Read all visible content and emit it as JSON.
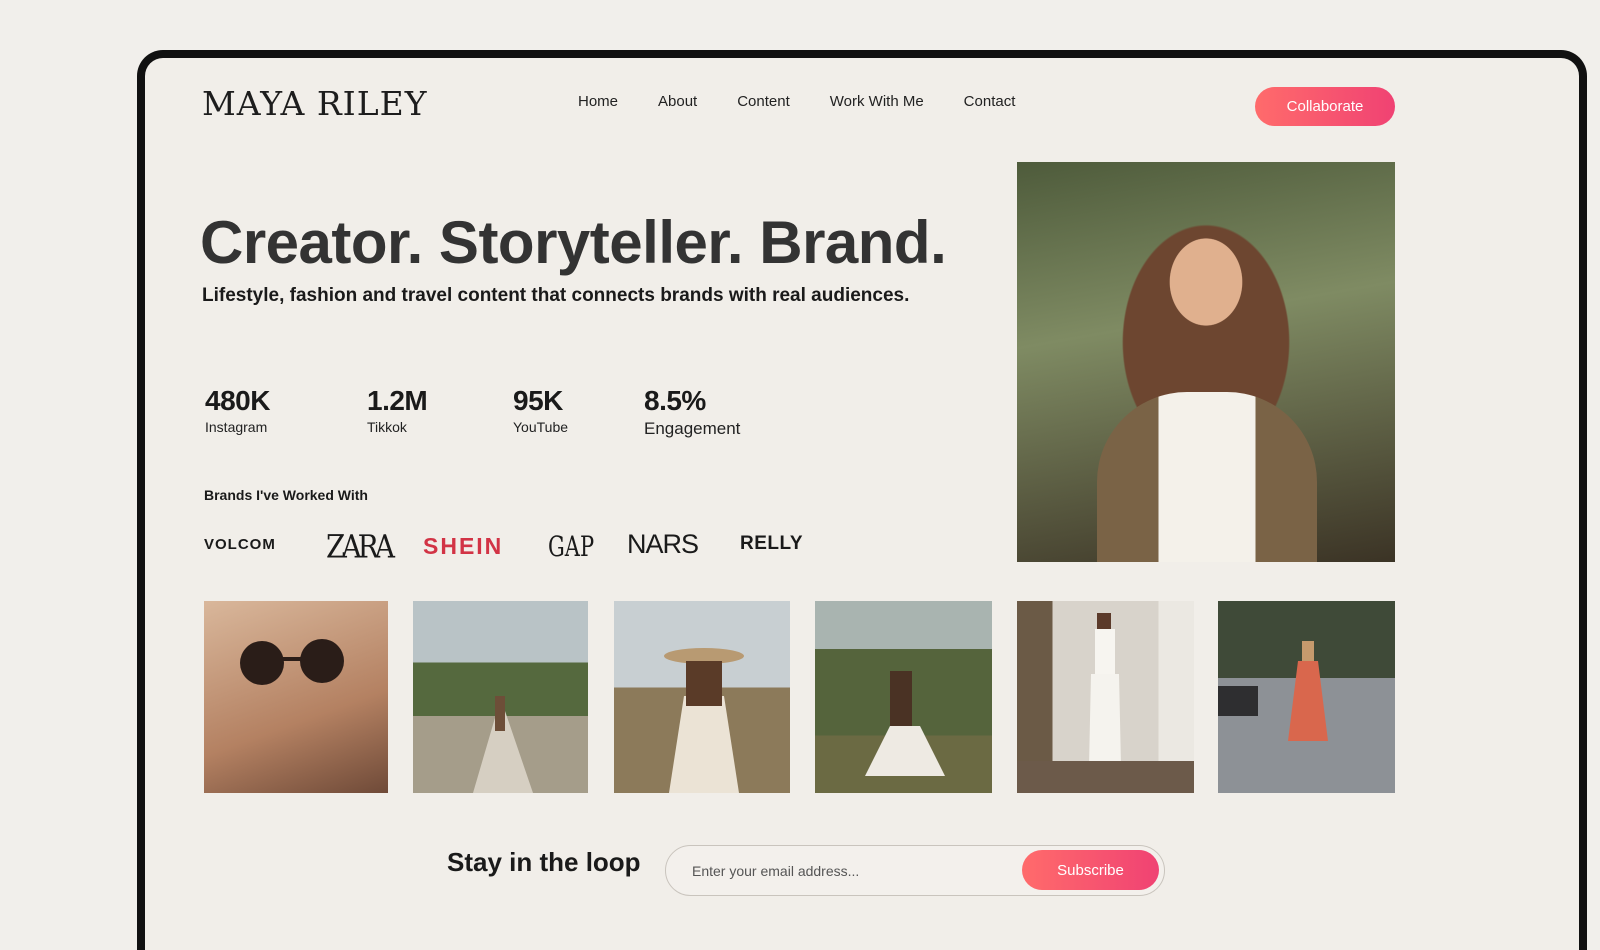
{
  "header": {
    "logo": "MAYA RILEY",
    "nav": [
      "Home",
      "About",
      "Content",
      "Work With Me",
      "Contact"
    ],
    "cta_label": "Collaborate"
  },
  "hero": {
    "title": "Creator. Storyteller. Brand.",
    "subtitle": "Lifestyle, fashion and travel content that connects brands with real audiences."
  },
  "stats": [
    {
      "value": "480K",
      "label": "Instagram"
    },
    {
      "value": "1.2M",
      "label": "Tikkok"
    },
    {
      "value": "95K",
      "label": "YouTube"
    },
    {
      "value": "8.5%",
      "label": "Engagement"
    }
  ],
  "brands": {
    "title": "Brands I've Worked With",
    "logos": [
      "VOLCOM",
      "ZARA",
      "SHEIN",
      "GAP",
      "NARS",
      "RELLY"
    ]
  },
  "newsletter": {
    "title": "Stay in the loop",
    "placeholder": "Enter your email address...",
    "button_label": "Subscribe"
  },
  "colors": {
    "accent_start": "#ff6b6b",
    "accent_end": "#f04273",
    "shein_red": "#d23345"
  }
}
